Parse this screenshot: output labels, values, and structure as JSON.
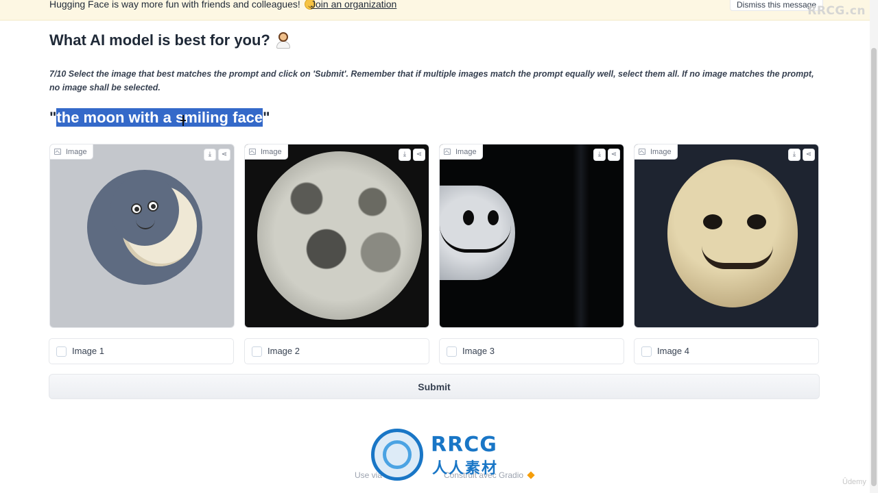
{
  "banner": {
    "text": "Hugging Face is way more fun with friends and colleagues!",
    "emoji_icon": "hugging-face-emoji-icon",
    "link": "Join an organization",
    "dismiss": "Dismiss this message"
  },
  "watermark": "RRCG.cn",
  "title": "What AI model is best for you?",
  "title_emoji_icon": "person-emoji-icon",
  "instructions": "7/10 Select the image that best matches the prompt and click on 'Submit'. Remember that if multiple images match the prompt equally well, select them all. If no image matches the prompt, no image shall be selected.",
  "prompt": {
    "open_quote": "\"",
    "text": "the moon with a smiling face",
    "close_quote": "\""
  },
  "images": [
    {
      "label": "Image"
    },
    {
      "label": "Image"
    },
    {
      "label": "Image"
    },
    {
      "label": "Image"
    }
  ],
  "options": [
    {
      "label": "Image 1",
      "checked": false
    },
    {
      "label": "Image 2",
      "checked": false
    },
    {
      "label": "Image 3",
      "checked": false
    },
    {
      "label": "Image 4",
      "checked": false
    }
  ],
  "submit_label": "Submit",
  "footer": {
    "left": "Use via",
    "right": "Construit avec Gradio"
  },
  "logo": {
    "text": "RRCG",
    "sub": "人人素材"
  },
  "udemy": "Ûdemy",
  "colors": {
    "banner_bg": "#fdf7e3",
    "highlight": "#3469c9",
    "logo_blue": "#1976c6"
  }
}
